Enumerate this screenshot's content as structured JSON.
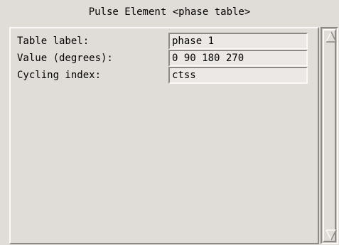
{
  "window": {
    "title": "Pulse Element <phase table>"
  },
  "form": {
    "rows": [
      {
        "label": "Table label:",
        "value": "phase 1"
      },
      {
        "label": "Value (degrees):",
        "value": "0 90 180 270"
      },
      {
        "label": "Cycling index:",
        "value": "ctss"
      }
    ]
  },
  "scrollbar": {
    "up_icon": "arrow-up-icon",
    "down_icon": "arrow-down-icon"
  },
  "colors": {
    "background": "#e0dcd8",
    "field_background": "#ebe8e5",
    "highlight": "#fbf9f7",
    "shadow": "#8c8884"
  }
}
